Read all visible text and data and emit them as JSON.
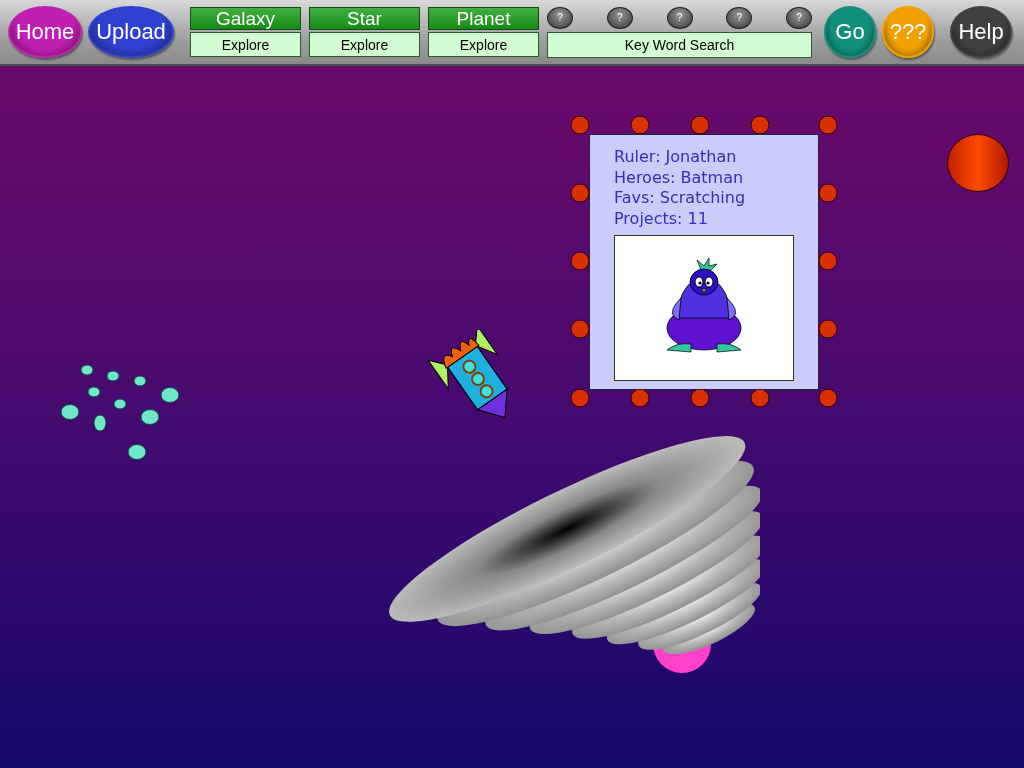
{
  "toolbar": {
    "nav_buttons": [
      {
        "label": "Home",
        "color": "#c020b0"
      },
      {
        "label": "Upload",
        "color": "#3040d0"
      }
    ],
    "explore_groups": [
      {
        "title": "Galaxy",
        "action": "Explore"
      },
      {
        "title": "Star",
        "action": "Explore"
      },
      {
        "title": "Planet",
        "action": "Explore"
      }
    ],
    "hint_buttons": [
      "?",
      "?",
      "?",
      "?",
      "?"
    ],
    "search": {
      "label": "Key Word Search"
    },
    "action_buttons": [
      {
        "label": "Go",
        "color": "#10907a"
      },
      {
        "label": "???",
        "color": "#f0a000"
      },
      {
        "label": "Help",
        "color": "#404040"
      }
    ]
  },
  "profile_card": {
    "lines": [
      "Ruler: Jonathan",
      "Heroes: Batman",
      "Favs: Scratching",
      "Projects:  11"
    ]
  }
}
